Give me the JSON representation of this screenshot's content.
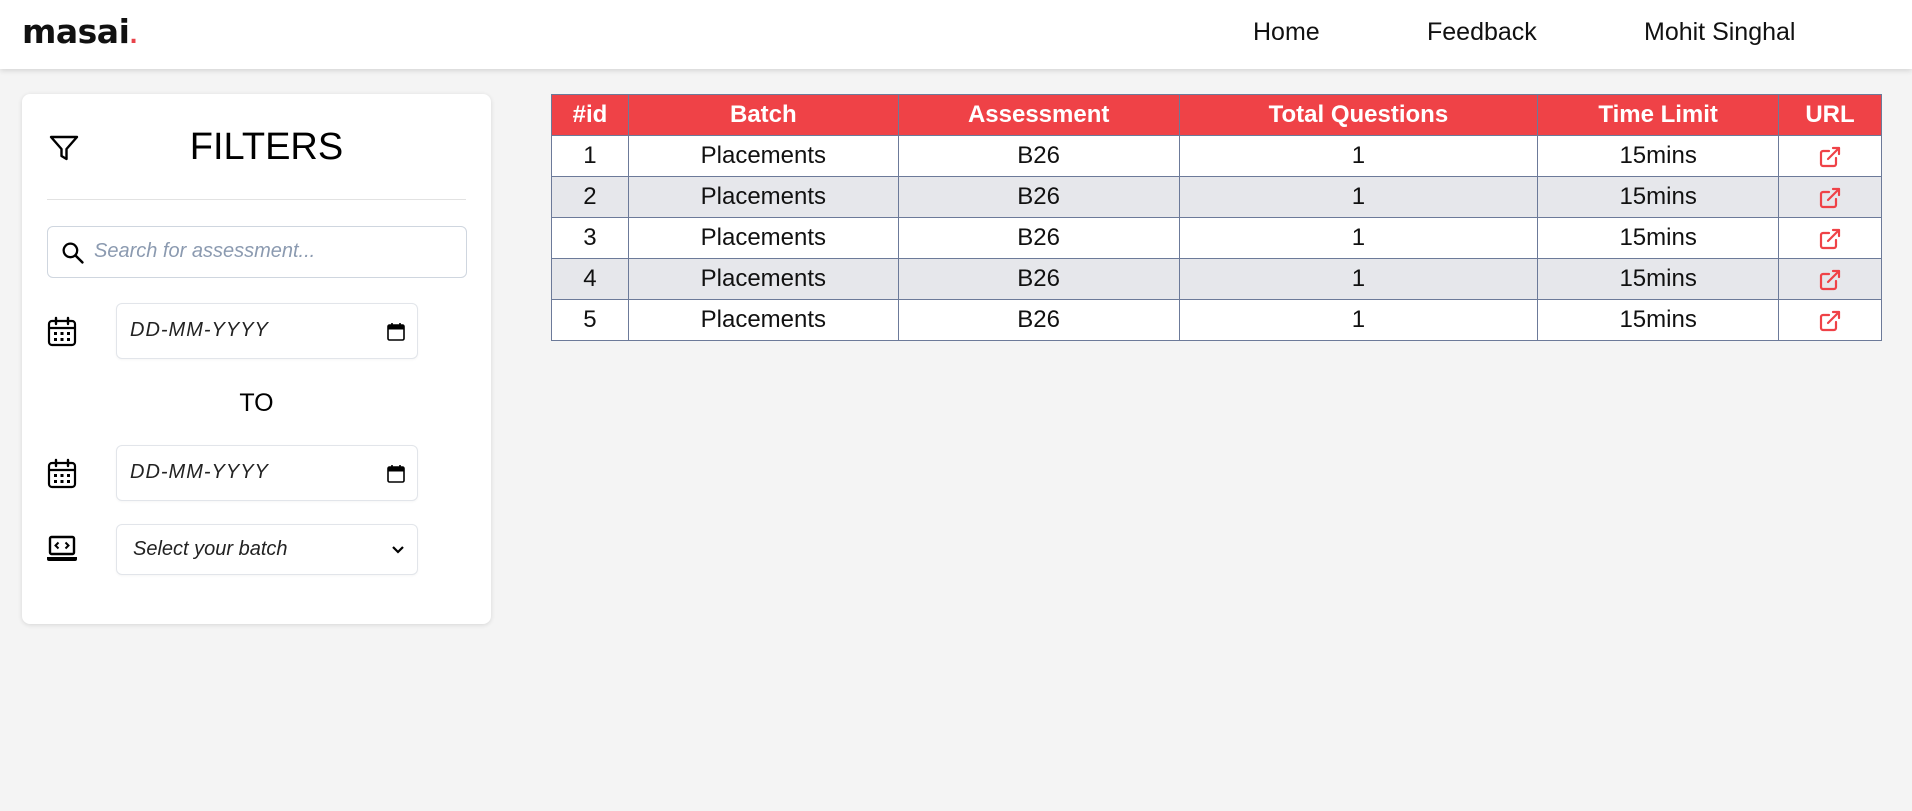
{
  "brand": {
    "name": "masai",
    "dot": "."
  },
  "nav": {
    "home": "Home",
    "feedback": "Feedback",
    "user": "Mohit Singhal"
  },
  "filters": {
    "title": "FILTERS",
    "search_placeholder": "Search for assessment...",
    "from_date_placeholder": "DD-MM-YYYY",
    "to_label": "TO",
    "to_date_placeholder": "DD-MM-YYYY",
    "batch_placeholder": "Select your batch"
  },
  "table": {
    "headers": [
      "#id",
      "Batch",
      "Assessment",
      "Total Questions",
      "Time Limit",
      "URL"
    ],
    "rows": [
      {
        "id": "1",
        "batch": "Placements",
        "assessment": "B26",
        "total_questions": "1",
        "time_limit": "15mins"
      },
      {
        "id": "2",
        "batch": "Placements",
        "assessment": "B26",
        "total_questions": "1",
        "time_limit": "15mins"
      },
      {
        "id": "3",
        "batch": "Placements",
        "assessment": "B26",
        "total_questions": "1",
        "time_limit": "15mins"
      },
      {
        "id": "4",
        "batch": "Placements",
        "assessment": "B26",
        "total_questions": "1",
        "time_limit": "15mins"
      },
      {
        "id": "5",
        "batch": "Placements",
        "assessment": "B26",
        "total_questions": "1",
        "time_limit": "15mins"
      }
    ]
  },
  "colors": {
    "accent": "#ef4247",
    "row_alt": "#e6e7eb",
    "page_bg": "#f4f4f4"
  },
  "icons": {
    "filter": "filter-icon",
    "search": "search-icon",
    "calendar": "calendar-icon",
    "laptop": "laptop-code-icon",
    "external_link": "external-link-icon",
    "chevron": "chevron-down-icon"
  }
}
